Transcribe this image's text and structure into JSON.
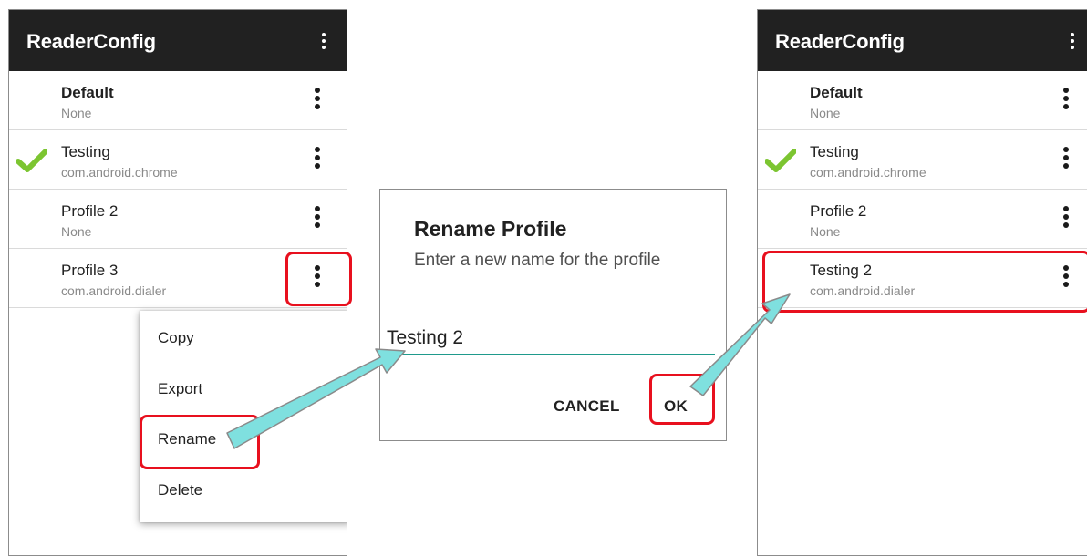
{
  "app_title": "ReaderConfig",
  "left_screen": {
    "profiles": [
      {
        "name": "Default",
        "package": "None",
        "bold": true
      },
      {
        "name": "Testing",
        "package": "com.android.chrome",
        "active": true
      },
      {
        "name": "Profile 2",
        "package": "None"
      },
      {
        "name": "Profile 3",
        "package": "com.android.dialer"
      }
    ],
    "context_menu": [
      "Copy",
      "Export",
      "Rename",
      "Delete"
    ]
  },
  "dialog": {
    "title": "Rename Profile",
    "message": "Enter a new name for the profile",
    "input_value": "Testing 2",
    "cancel_label": "CANCEL",
    "ok_label": "OK"
  },
  "right_screen": {
    "profiles": [
      {
        "name": "Default",
        "package": "None",
        "bold": true
      },
      {
        "name": "Testing",
        "package": "com.android.chrome",
        "active": true
      },
      {
        "name": "Profile 2",
        "package": "None"
      },
      {
        "name": "Testing 2",
        "package": "com.android.dialer"
      }
    ]
  },
  "colors": {
    "appbar": "#212121",
    "highlight": "#e8101e",
    "arrow": "#7fe0df",
    "input_underline": "#1f9a8c",
    "check": "#7cc531"
  },
  "icons": [
    "more-vert-icon",
    "checkmark-icon",
    "annotation-arrow"
  ]
}
